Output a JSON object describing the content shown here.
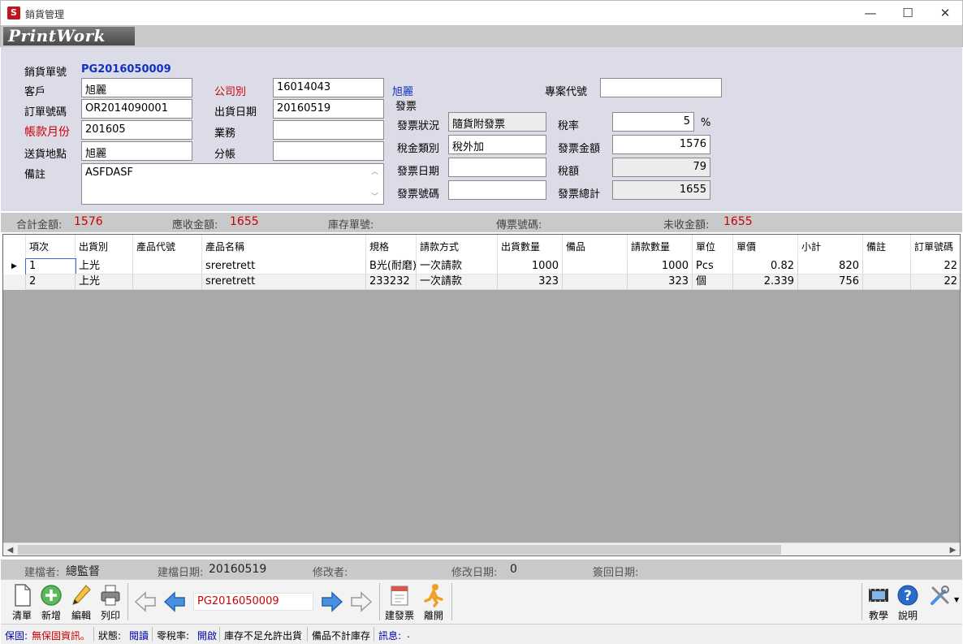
{
  "window": {
    "title": "銷貨管理",
    "icon_glyph": "S",
    "minimize": "—",
    "maximize": "☐",
    "close": "✕"
  },
  "logo": "PrintWork",
  "form": {
    "order_no_label": "銷貨單號",
    "order_no_value": "PG2016050009",
    "customer_label": "客戶",
    "customer_value": "旭麗",
    "company_label": "公司別",
    "company_value": "16014043",
    "company_name": "旭麗",
    "order_label": "訂單號碼",
    "order_value": "OR2014090001",
    "ship_date_label": "出貨日期",
    "ship_date_value": "20160519",
    "bill_month_label": "帳款月份",
    "bill_month_value": "201605",
    "sales_label": "業務",
    "sales_value": "",
    "addr_label": "送貨地點",
    "addr_value": "旭麗",
    "branch_label": "分帳",
    "branch_value": "",
    "note_label": "備註",
    "note_value": "ASFDASF",
    "invoice_section": "發票",
    "inv_status_label": "發票狀況",
    "inv_status_value": "隨貨附發票",
    "tax_type_label": "稅金類別",
    "tax_type_value": "稅外加",
    "inv_date_label": "發票日期",
    "inv_date_value": "",
    "inv_no_label": "發票號碼",
    "inv_no_value": "",
    "project_label": "專案代號",
    "project_value": "",
    "tax_rate_label": "稅率",
    "tax_rate_value": "5",
    "percent": "%",
    "inv_amount_label": "發票金額",
    "inv_amount_value": "1576",
    "tax_label": "稅額",
    "tax_value": "79",
    "inv_total_label": "發票總計",
    "inv_total_value": "1655"
  },
  "totals": {
    "sum_label": "合計金額:",
    "sum_value": "1576",
    "receivable_label": "應收金額:",
    "receivable_value": "1655",
    "stock_label": "庫存單號:",
    "stock_value": "",
    "slip_label": "傳票號碼:",
    "slip_value": "",
    "unpaid_label": "未收金額:",
    "unpaid_value": "1655"
  },
  "grid": {
    "headers": [
      "項次",
      "出貨別",
      "產品代號",
      "產品名稱",
      "規格",
      "請款方式",
      "出貨數量",
      "備品",
      "請款數量",
      "單位",
      "單價",
      "小計",
      "備註",
      "訂單號碼"
    ],
    "rows": [
      [
        "1",
        "上光",
        "",
        "sreretrett",
        "B光(耐磨)",
        "一次請款",
        "1000",
        "",
        "1000",
        "Pcs",
        "0.82",
        "820",
        "",
        "22"
      ],
      [
        "2",
        "上光",
        "",
        "sreretrett",
        "233232",
        "一次請款",
        "323",
        "",
        "323",
        "個",
        "2.339",
        "756",
        "",
        "22"
      ]
    ],
    "current_row_marker": "▶"
  },
  "info": {
    "creator_label": "建檔者:",
    "creator_value": "總監督",
    "create_date_label": "建檔日期:",
    "create_date_value": "20160519",
    "modifier_label": "修改者:",
    "modifier_value": "",
    "modify_date_label": "修改日期:",
    "modify_date_value": "0",
    "return_date_label": "簽回日期:",
    "return_date_value": ""
  },
  "toolbar": {
    "list": "清單",
    "add": "新增",
    "edit": "編輯",
    "print": "列印",
    "nav_value": "PG2016050009",
    "invoice": "建發票",
    "leave": "離開",
    "tutorial": "教學",
    "help": "說明"
  },
  "status": {
    "warranty_label": "保固:",
    "warranty_value": "無保固資訊。",
    "state_label": "狀態:",
    "state_value": "閱讀",
    "zero_tax_label": "零稅率:",
    "zero_tax_value": "開啟",
    "stock_rule": "庫存不足允許出貨",
    "spare_rule": "備品不計庫存",
    "msg_label": "訊息:",
    "msg_value": "."
  },
  "colors": {
    "form_bg": "#dcdce8",
    "accent_red": "#cc0000",
    "accent_blue": "#1030c0",
    "grid_bg": "#a9a9a9"
  }
}
